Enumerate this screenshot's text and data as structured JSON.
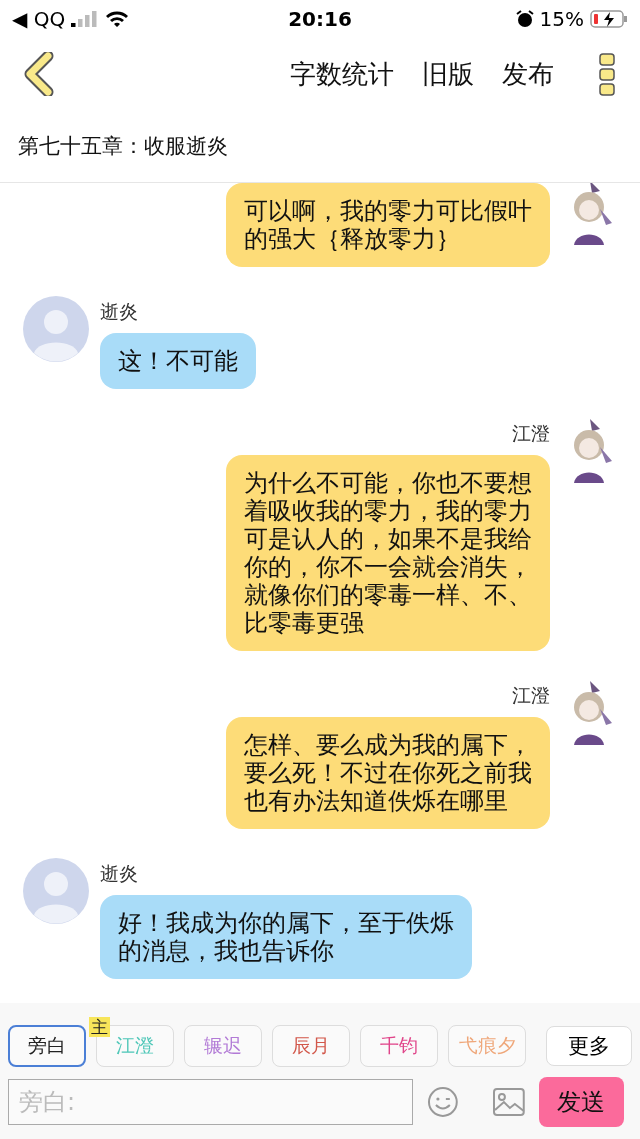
{
  "status_bar": {
    "back_label": "◀ QQ",
    "time": "20:16",
    "battery": "15%"
  },
  "header": {
    "actions": [
      "字数统计",
      "旧版",
      "发布"
    ]
  },
  "chapter_title": "第七十五章：收服逝炎",
  "messages": [
    {
      "kind": "right",
      "text": "可以啊，我的零力可比假叶的强大｛释放零力｝"
    },
    {
      "kind": "left",
      "name": "逝炎",
      "text": "这！不可能"
    },
    {
      "kind": "right",
      "name": "江澄",
      "text": "为什么不可能，你也不要想着吸收我的零力，我的零力可是认人的，如果不是我给你的，你不一会就会消失，就像你们的零毒一样、不、比零毒更强"
    },
    {
      "kind": "right",
      "name": "江澄",
      "text": "怎样、要么成为我的属下，要么死！不过在你死之前我也有办法知道佚烁在哪里"
    },
    {
      "kind": "left",
      "name": "逝炎",
      "text": "好！我成为你的属下，至于佚烁的消息，我也告诉你"
    }
  ],
  "roles": [
    {
      "label": "旁白",
      "color": "#222222",
      "selected": true
    },
    {
      "label": "江澄",
      "color": "#4fc7b8",
      "selected": false,
      "badge": "主"
    },
    {
      "label": "辗迟",
      "color": "#b27ad6",
      "selected": false
    },
    {
      "label": "辰月",
      "color": "#d2574a",
      "selected": false
    },
    {
      "label": "千钧",
      "color": "#e0458a",
      "selected": false
    },
    {
      "label": "弋痕夕",
      "color": "#efa77a",
      "selected": false
    }
  ],
  "more_button": "更多",
  "input": {
    "placeholder": "旁白:"
  },
  "send_button": "发送"
}
